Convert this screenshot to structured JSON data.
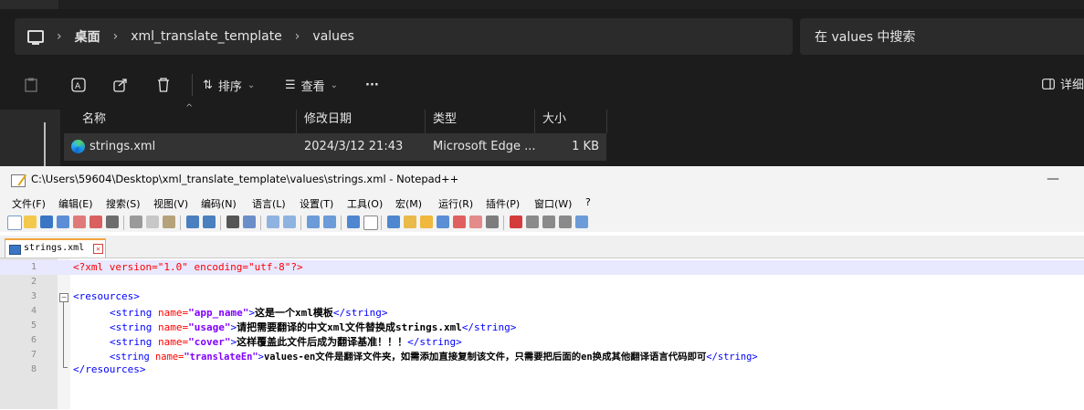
{
  "explorer": {
    "breadcrumbs": [
      "桌面",
      "xml_translate_template",
      "values"
    ],
    "search_placeholder": "在 values 中搜索",
    "toolbar": {
      "sort_label": "排序",
      "view_label": "查看",
      "more_label": "···",
      "details_label": "详细"
    },
    "columns": [
      "名称",
      "修改日期",
      "类型",
      "大小"
    ],
    "files": [
      {
        "name": "strings.xml",
        "modified": "2024/3/12 21:43",
        "type": "Microsoft Edge ...",
        "size": "1 KB"
      }
    ]
  },
  "notepad": {
    "title": "C:\\Users\\59604\\Desktop\\xml_translate_template\\values\\strings.xml - Notepad++",
    "minimize": "—",
    "menu": [
      "文件(F)",
      "编辑(E)",
      "搜索(S)",
      "视图(V)",
      "编码(N)",
      "语言(L)",
      "设置(T)",
      "工具(O)",
      "宏(M)",
      "运行(R)",
      "插件(P)",
      "窗口(W)",
      "?"
    ],
    "tab": {
      "name": "strings.xml",
      "close": "✕"
    },
    "line_numbers": [
      "1",
      "2",
      "3",
      "4",
      "5",
      "6",
      "7",
      "8"
    ],
    "code": {
      "l1": "<?xml version=\"1.0\" encoding=\"utf-8\"?>",
      "l3": "<resources>",
      "open_tag": "<string",
      "name_attr": " name=",
      "close_open": ">",
      "end_tag": "</string>",
      "l8": "</resources>",
      "strings": [
        {
          "name": "\"app_name\"",
          "text": "这是一个xml模板"
        },
        {
          "name": "\"usage\"",
          "text": "请把需要翻译的中文xml文件替换成strings.xml"
        },
        {
          "name": "\"cover\"",
          "text": "这样覆盖此文件后成为翻译基准！！！"
        },
        {
          "name": "\"translateEn\"",
          "text": "values-en文件是翻译文件夹，如需添加直接复制该文件，只需要把后面的en换成其他翻译语言代码即可"
        }
      ]
    }
  }
}
